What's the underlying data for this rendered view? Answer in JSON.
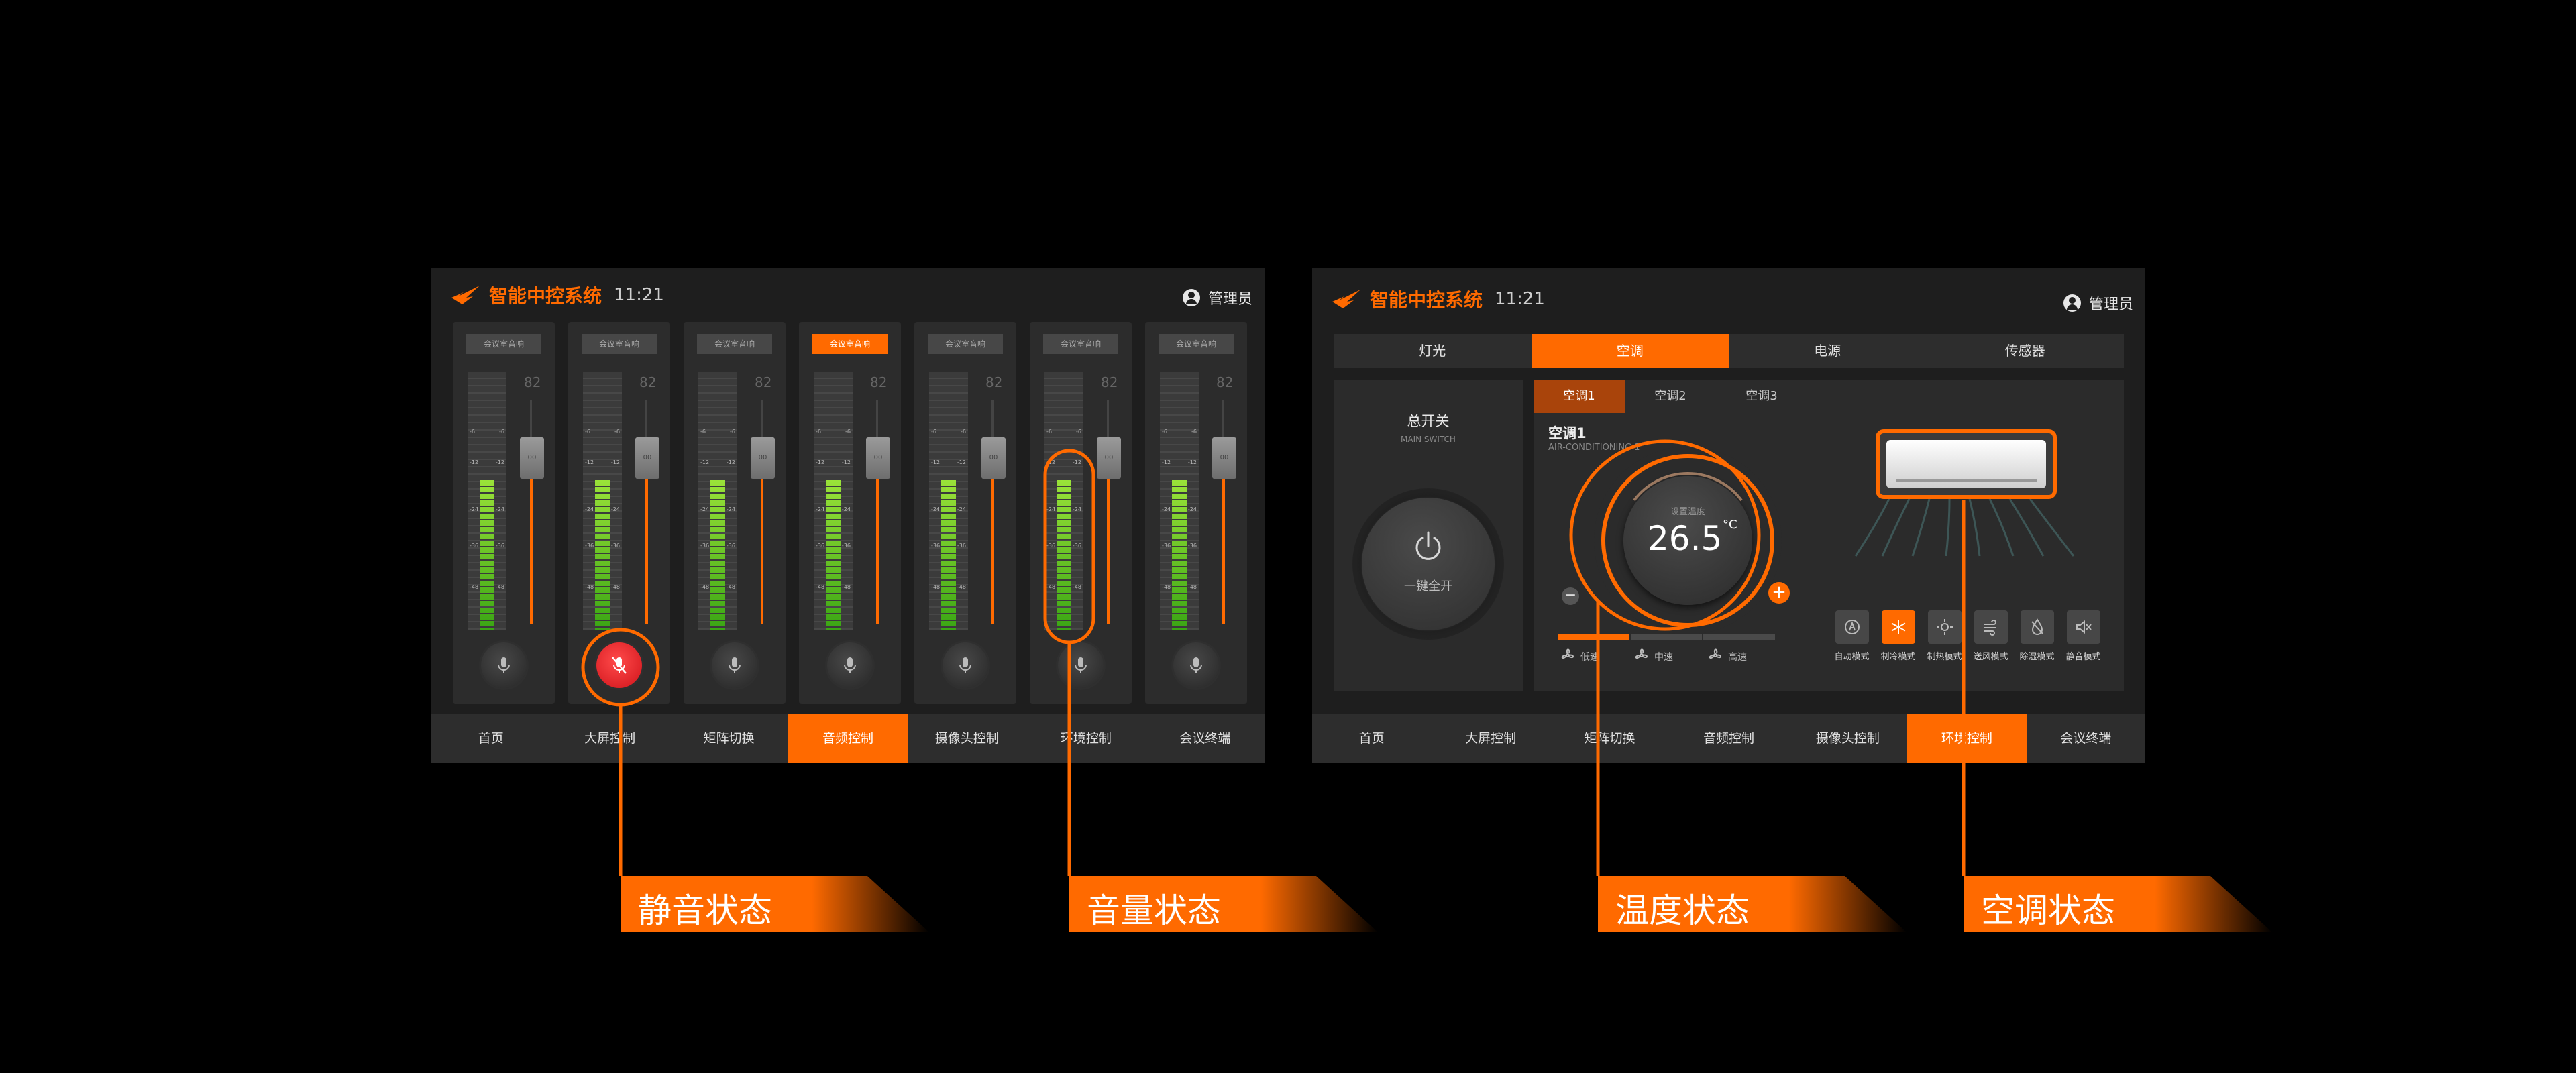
{
  "system": {
    "title": "智能中控系统",
    "time": "11:21",
    "user": "管理员"
  },
  "audio": {
    "channels": [
      {
        "label": "会议室音响",
        "active": false,
        "muted": false,
        "value": "82",
        "knob": "00"
      },
      {
        "label": "会议室音响",
        "active": false,
        "muted": true,
        "value": "82",
        "knob": "00"
      },
      {
        "label": "会议室音响",
        "active": false,
        "muted": false,
        "value": "82",
        "knob": "00"
      },
      {
        "label": "会议室音响",
        "active": true,
        "muted": false,
        "value": "82",
        "knob": "00"
      },
      {
        "label": "会议室音响",
        "active": false,
        "muted": false,
        "value": "82",
        "knob": "00"
      },
      {
        "label": "会议室音响",
        "active": false,
        "muted": false,
        "value": "82",
        "knob": "00"
      },
      {
        "label": "会议室音响",
        "active": false,
        "muted": false,
        "value": "82",
        "knob": "00"
      }
    ],
    "meter_level": 0.58,
    "meter_marks": [
      "-6",
      "-12",
      "-24",
      "-36",
      "-48"
    ]
  },
  "nav": {
    "items": [
      "首页",
      "大屏控制",
      "矩阵切换",
      "音频控制",
      "摄像头控制",
      "环境控制",
      "会议终端"
    ],
    "audio_active": 3,
    "env_active": 5
  },
  "env": {
    "tabs": [
      "灯光",
      "空调",
      "电源",
      "传感器"
    ],
    "active_tab": 1,
    "switch": {
      "title": "总开关",
      "subtitle": "MAIN SWITCH",
      "button": "一键全开"
    },
    "ac_tabs": [
      "空调1",
      "空调2",
      "空调3"
    ],
    "ac_active": 0,
    "ac_name": "空调1",
    "ac_en": "AIR-CONDITIONING 1",
    "dial": {
      "caption": "设置温度",
      "value": "26.5",
      "unit": "°C",
      "minus": "−",
      "plus": "+"
    },
    "speed_level": 1,
    "speeds": [
      "低速",
      "中速",
      "高速"
    ],
    "modes": [
      {
        "label": "自动模式",
        "icon": "auto-icon"
      },
      {
        "label": "制冷模式",
        "icon": "snowflake-icon",
        "active": true
      },
      {
        "label": "制热模式",
        "icon": "sun-icon"
      },
      {
        "label": "送风模式",
        "icon": "wind-icon"
      },
      {
        "label": "除湿模式",
        "icon": "drop-icon"
      },
      {
        "label": "静音模式",
        "icon": "mute-icon"
      }
    ]
  },
  "callouts": {
    "mute": "静音状态",
    "volume": "音量状态",
    "temperature": "温度状态",
    "ac": "空调状态"
  },
  "colors": {
    "accent": "#ff6a00",
    "mute": "#e0262d",
    "meter": "#6fcf2a"
  }
}
